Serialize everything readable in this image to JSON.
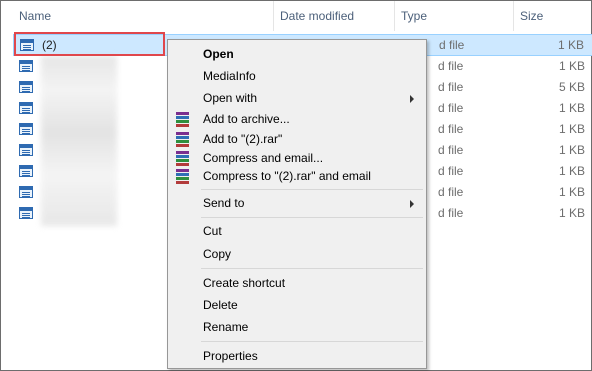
{
  "columns": {
    "name": "Name",
    "date_modified": "Date modified",
    "type": "Type",
    "size": "Size"
  },
  "files": [
    {
      "name": "(2)",
      "type": "d file",
      "size": "1 KB",
      "selected": true
    },
    {
      "name": "",
      "type": "d file",
      "size": "1 KB"
    },
    {
      "name": "",
      "type": "d file",
      "size": "5 KB"
    },
    {
      "name": "",
      "type": "d file",
      "size": "1 KB"
    },
    {
      "name": "",
      "type": "d file",
      "size": "1 KB"
    },
    {
      "name": "",
      "type": "d file",
      "size": "1 KB"
    },
    {
      "name": "",
      "type": "d file",
      "size": "1 KB"
    },
    {
      "name": "",
      "type": "d file",
      "size": "1 KB"
    },
    {
      "name": "",
      "type": "d file",
      "size": "1 KB"
    }
  ],
  "context_menu": {
    "open": "Open",
    "mediainfo": "MediaInfo",
    "open_with": "Open with",
    "add_to_archive": "Add to archive...",
    "add_to_rar": "Add to \"(2).rar\"",
    "compress_email": "Compress and email...",
    "compress_rar_email": "Compress to \"(2).rar\" and email",
    "send_to": "Send to",
    "cut": "Cut",
    "copy": "Copy",
    "create_shortcut": "Create shortcut",
    "delete": "Delete",
    "rename": "Rename",
    "properties": "Properties"
  },
  "colors": {
    "selection": "#cde8ff",
    "highlight_box": "#e0474c",
    "header_text": "#4c607a"
  },
  "icons": {
    "file": "document-file-icon",
    "archive": "winrar-archive-icon",
    "submenu": "chevron-right-icon"
  }
}
